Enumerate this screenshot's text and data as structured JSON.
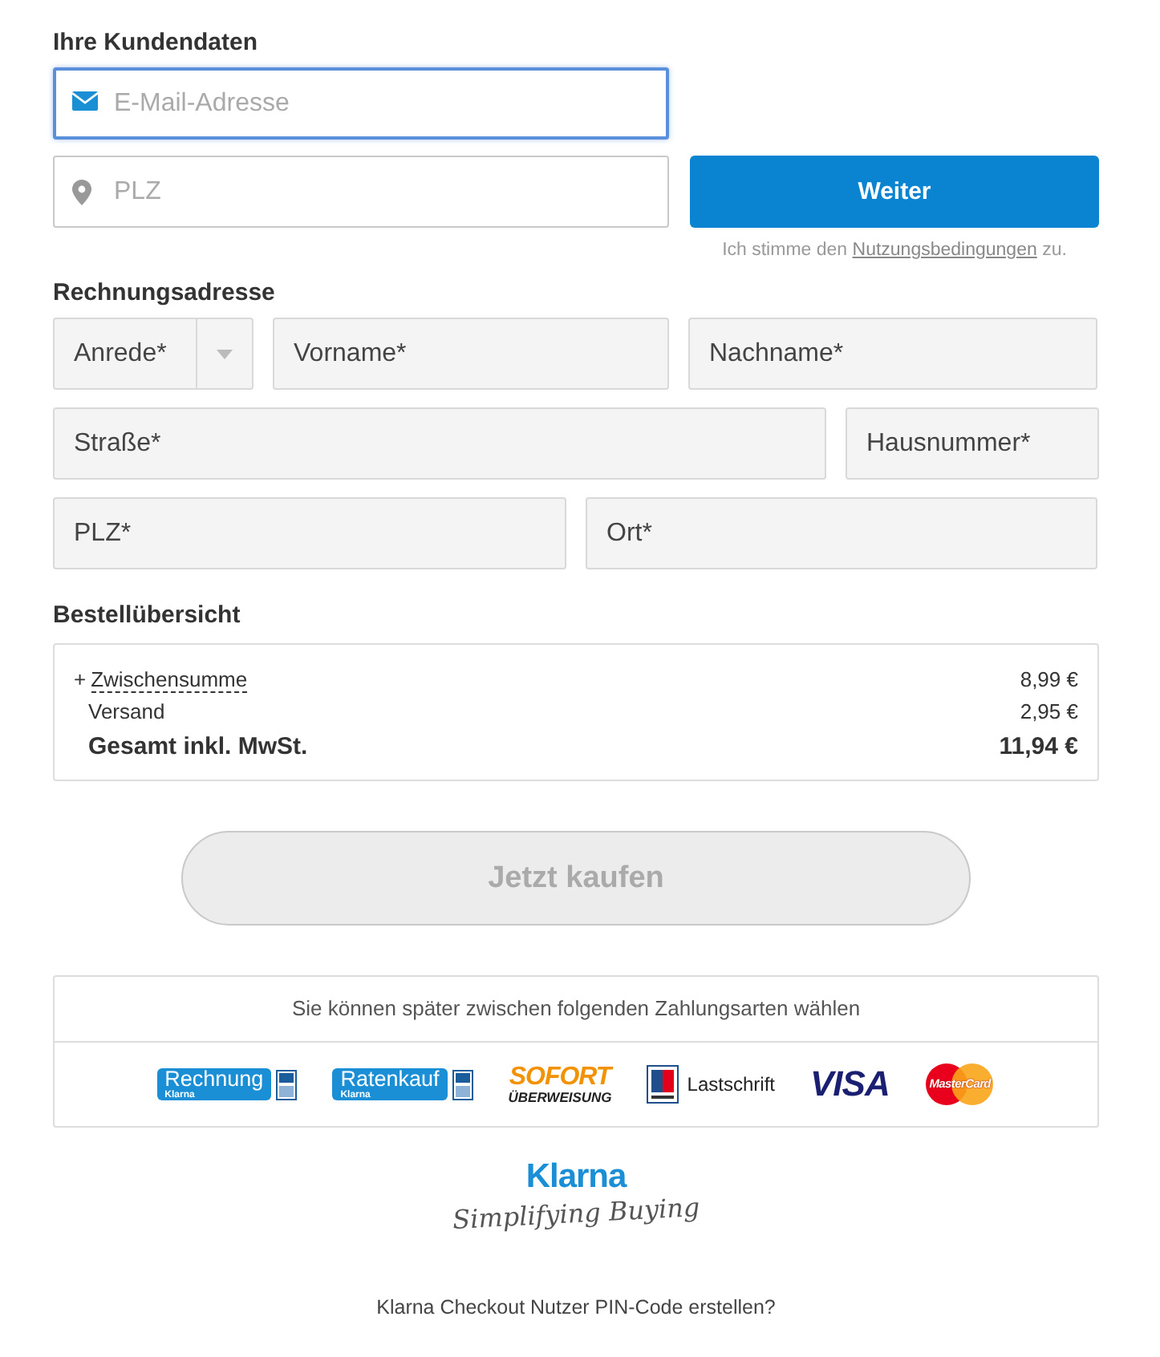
{
  "customer": {
    "heading": "Ihre Kundendaten",
    "email": {
      "placeholder": "E-Mail-Adresse",
      "focused": true
    },
    "zip": {
      "placeholder": "PLZ",
      "focused": false
    },
    "continue_button": "Weiter",
    "terms": {
      "before": "Ich stimme den",
      "link": "Nutzungsbedingungen",
      "after": "zu."
    }
  },
  "billing": {
    "heading": "Rechnungsadresse",
    "rows": [
      [
        {
          "kind": "select",
          "placeholder": "Anrede*"
        },
        {
          "kind": "text",
          "placeholder": "Vorname*"
        },
        {
          "kind": "text",
          "placeholder": "Nachname*"
        }
      ],
      [
        {
          "kind": "text",
          "placeholder": "Straße*"
        },
        {
          "kind": "text",
          "placeholder": "Hausnummer*"
        }
      ],
      [
        {
          "kind": "text",
          "placeholder": "PLZ*"
        },
        {
          "kind": "text",
          "placeholder": "Ort*"
        }
      ]
    ]
  },
  "order": {
    "heading": "Bestellübersicht",
    "lines": [
      {
        "kind": "expandable",
        "toggle": "+",
        "label": "Zwischensumme",
        "amount": "8,99 €"
      },
      {
        "kind": "plain",
        "label": "Versand",
        "amount": "2,95 €"
      },
      {
        "kind": "total",
        "label": "Gesamt inkl. MwSt.",
        "amount": "11,94 €"
      }
    ]
  },
  "buy_button": {
    "label": "Jetzt kaufen",
    "disabled": true
  },
  "payment": {
    "caption": "Sie können später zwischen folgenden Zahlungsarten wählen",
    "methods": [
      {
        "kind": "klarna",
        "label": "Rechnung",
        "sub": "Klarna"
      },
      {
        "kind": "klarna",
        "label": "Ratenkauf",
        "sub": "Klarna"
      },
      {
        "kind": "sofort",
        "label": "SOFORT",
        "sub": "ÜBERWEISUNG"
      },
      {
        "kind": "lastschrift",
        "label": "Lastschrift"
      },
      {
        "kind": "visa",
        "label": "VISA"
      },
      {
        "kind": "mastercard",
        "label": "MasterCard"
      }
    ]
  },
  "brand": {
    "name": "Klarna",
    "tagline": "Simplifying Buying"
  },
  "footer_link": "Klarna Checkout Nutzer PIN-Code erstellen?"
}
